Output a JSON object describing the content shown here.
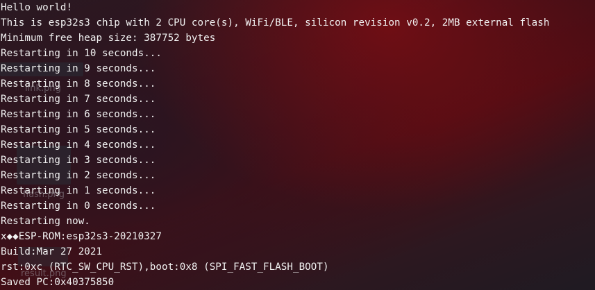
{
  "desktop": {
    "icons": [
      {
        "name": "link.png"
      },
      {
        "name": "flash.png"
      },
      {
        "name": "result.png"
      }
    ]
  },
  "terminal": {
    "lines": [
      "Hello world!",
      "This is esp32s3 chip with 2 CPU core(s), WiFi/BLE, silicon revision v0.2, 2MB external flash",
      "Minimum free heap size: 387752 bytes",
      "Restarting in 10 seconds...",
      "Restarting in 9 seconds...",
      "Restarting in 8 seconds...",
      "Restarting in 7 seconds...",
      "Restarting in 6 seconds...",
      "Restarting in 5 seconds...",
      "Restarting in 4 seconds...",
      "Restarting in 3 seconds...",
      "Restarting in 2 seconds...",
      "Restarting in 1 seconds...",
      "Restarting in 0 seconds...",
      "Restarting now.",
      "x◆◆ESP-ROM:esp32s3-20210327",
      "Build:Mar 27 2021",
      "rst:0xc (RTC_SW_CPU_RST),boot:0x8 (SPI_FAST_FLASH_BOOT)",
      "Saved PC:0x40375850"
    ]
  }
}
